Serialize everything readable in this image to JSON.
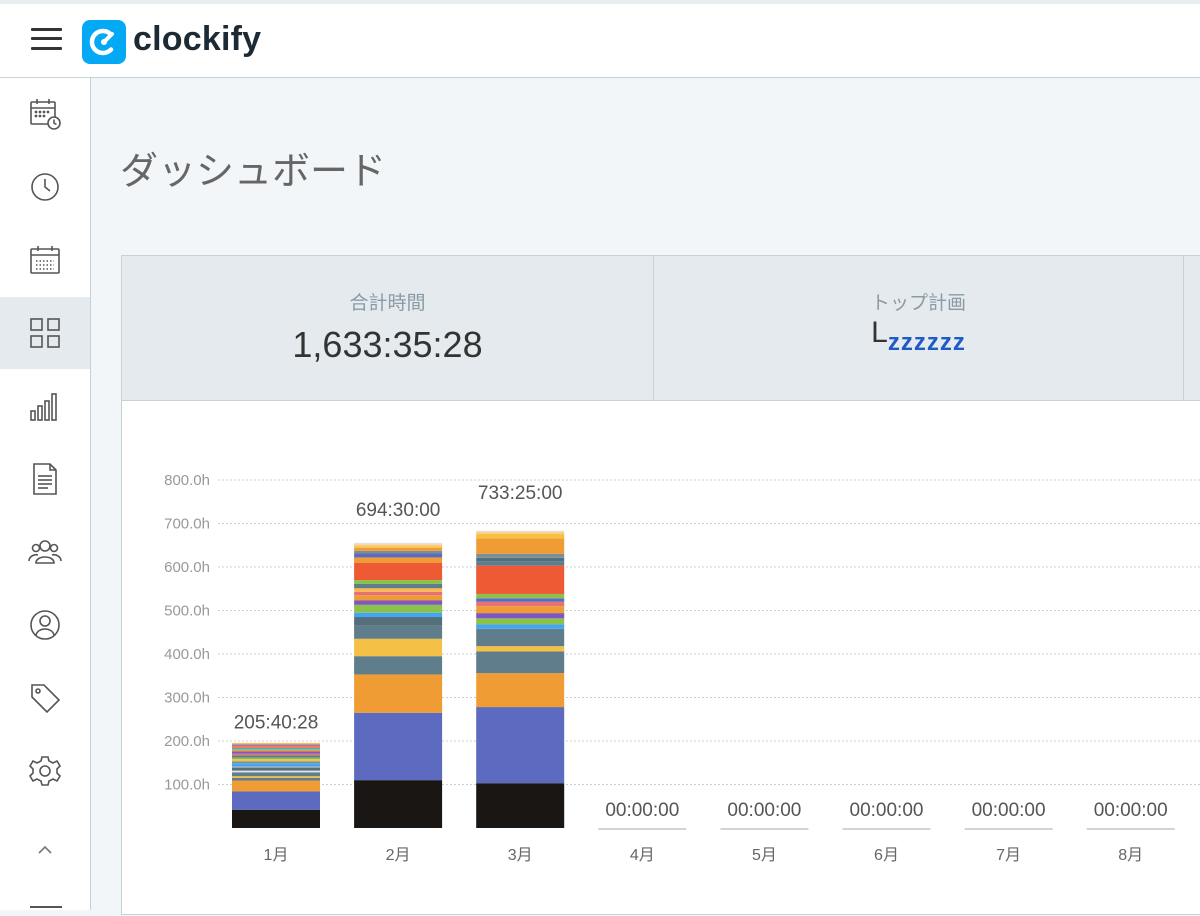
{
  "app": {
    "name": "clockify"
  },
  "sidebar": {
    "items": [
      {
        "icon": "timesheet-icon",
        "label": ""
      },
      {
        "icon": "clock-icon",
        "label": ""
      },
      {
        "icon": "calendar-icon",
        "label": ""
      },
      {
        "icon": "dashboard-icon",
        "label": "",
        "active": true
      },
      {
        "icon": "reports-icon",
        "label": ""
      },
      {
        "icon": "projects-icon",
        "label": ""
      },
      {
        "icon": "team-icon",
        "label": ""
      },
      {
        "icon": "clients-icon",
        "label": ""
      },
      {
        "icon": "tag-icon",
        "label": ""
      },
      {
        "icon": "settings-icon",
        "label": ""
      },
      {
        "icon": "chevron-up-icon",
        "label": ""
      }
    ]
  },
  "page": {
    "title": "ダッシュボード"
  },
  "summary": {
    "total_label": "合計時間",
    "total_value": "1,633:35:28",
    "top_project_label": "トップ計画",
    "top_project_value": "L",
    "top_project_zzz": "zzzzzz"
  },
  "colors": {
    "brand": "#03a9f4",
    "zzz": "#1e5bc6",
    "grid": "#cfcfcf",
    "axis_text": "#999999"
  },
  "chart_data": {
    "type": "bar",
    "stacked": true,
    "categories": [
      "1月",
      "2月",
      "3月",
      "4月",
      "5月",
      "6月",
      "7月",
      "8月"
    ],
    "totals": [
      205.67,
      694.5,
      733.42,
      0,
      0,
      0,
      0,
      0
    ],
    "total_labels": [
      "205:40:28",
      "694:30:00",
      "733:25:00",
      "00:00:00",
      "00:00:00",
      "00:00:00",
      "00:00:00",
      "00:00:00"
    ],
    "yticks": [
      100,
      200,
      300,
      400,
      500,
      600,
      700,
      800
    ],
    "ytick_labels": [
      "100.0h",
      "200.0h",
      "300.0h",
      "400.0h",
      "500.0h",
      "600.0h",
      "700.0h",
      "800.0h"
    ],
    "ylim": [
      0,
      800
    ],
    "grid": true,
    "segments": [
      [
        {
          "v": 42,
          "c": "#1a1614"
        },
        {
          "v": 42,
          "c": "#5c6bc0"
        },
        {
          "v": 25,
          "c": "#f09c35"
        },
        {
          "v": 6,
          "c": "#607d8b"
        },
        {
          "v": 4,
          "c": "#f4c146"
        },
        {
          "v": 9,
          "c": "#607d8b"
        },
        {
          "v": 4,
          "c": "#e0e0e0"
        },
        {
          "v": 6,
          "c": "#546e7a"
        },
        {
          "v": 4,
          "c": "#90a4ae"
        },
        {
          "v": 7,
          "c": "#42a5f5"
        },
        {
          "v": 4,
          "c": "#78909c"
        },
        {
          "v": 5,
          "c": "#f4c146"
        },
        {
          "v": 4,
          "c": "#8bc34a"
        },
        {
          "v": 5,
          "c": "#607d8b"
        },
        {
          "v": 4,
          "c": "#e57373"
        },
        {
          "v": 5,
          "c": "#7e57c2"
        },
        {
          "v": 4,
          "c": "#f09c35"
        },
        {
          "v": 4,
          "c": "#4db6ac"
        },
        {
          "v": 4,
          "c": "#ff7043"
        },
        {
          "v": 4,
          "c": "#9575cd"
        },
        {
          "v": 3.67,
          "c": "#f4c146"
        }
      ],
      [
        {
          "v": 110,
          "c": "#1a1614"
        },
        {
          "v": 155,
          "c": "#5c6bc0"
        },
        {
          "v": 88,
          "c": "#f09c35"
        },
        {
          "v": 42,
          "c": "#607d8b"
        },
        {
          "v": 40,
          "c": "#f4c146"
        },
        {
          "v": 30,
          "c": "#607d8b"
        },
        {
          "v": 20,
          "c": "#546e7a"
        },
        {
          "v": 10,
          "c": "#42a5f5"
        },
        {
          "v": 18,
          "c": "#8bc34a"
        },
        {
          "v": 10,
          "c": "#7e57c2"
        },
        {
          "v": 12,
          "c": "#f09c35"
        },
        {
          "v": 8,
          "c": "#e57373"
        },
        {
          "v": 8,
          "c": "#ffb74d"
        },
        {
          "v": 10,
          "c": "#607d8b"
        },
        {
          "v": 9,
          "c": "#8bc34a"
        },
        {
          "v": 40,
          "c": "#ee5a34"
        },
        {
          "v": 12,
          "c": "#f09c35"
        },
        {
          "v": 9,
          "c": "#5c6bc0"
        },
        {
          "v": 6,
          "c": "#78909c"
        },
        {
          "v": 7,
          "c": "#f09c35"
        },
        {
          "v": 4,
          "c": "#f4c146"
        },
        {
          "v": 4,
          "c": "#ffcc80"
        },
        {
          "v": 3.5,
          "c": "#e0e0e0"
        }
      ],
      [
        {
          "v": 103,
          "c": "#1a1614"
        },
        {
          "v": 175,
          "c": "#5c6bc0"
        },
        {
          "v": 78,
          "c": "#f09c35"
        },
        {
          "v": 50,
          "c": "#607d8b"
        },
        {
          "v": 12,
          "c": "#f4c146"
        },
        {
          "v": 40,
          "c": "#607d8b"
        },
        {
          "v": 10,
          "c": "#42a5f5"
        },
        {
          "v": 14,
          "c": "#8bc34a"
        },
        {
          "v": 12,
          "c": "#7e57c2"
        },
        {
          "v": 16,
          "c": "#f09c35"
        },
        {
          "v": 10,
          "c": "#e57373"
        },
        {
          "v": 8,
          "c": "#5c6bc0"
        },
        {
          "v": 10,
          "c": "#8bc34a"
        },
        {
          "v": 65,
          "c": "#ee5a34"
        },
        {
          "v": 10,
          "c": "#607d8b"
        },
        {
          "v": 8,
          "c": "#546e7a"
        },
        {
          "v": 9,
          "c": "#78909c"
        },
        {
          "v": 36,
          "c": "#f09c35"
        },
        {
          "v": 10,
          "c": "#f4c146"
        },
        {
          "v": 5,
          "c": "#ffcc80"
        },
        {
          "v": 2.42,
          "c": "#e0e0e0"
        }
      ],
      [],
      [],
      [],
      [],
      []
    ]
  }
}
